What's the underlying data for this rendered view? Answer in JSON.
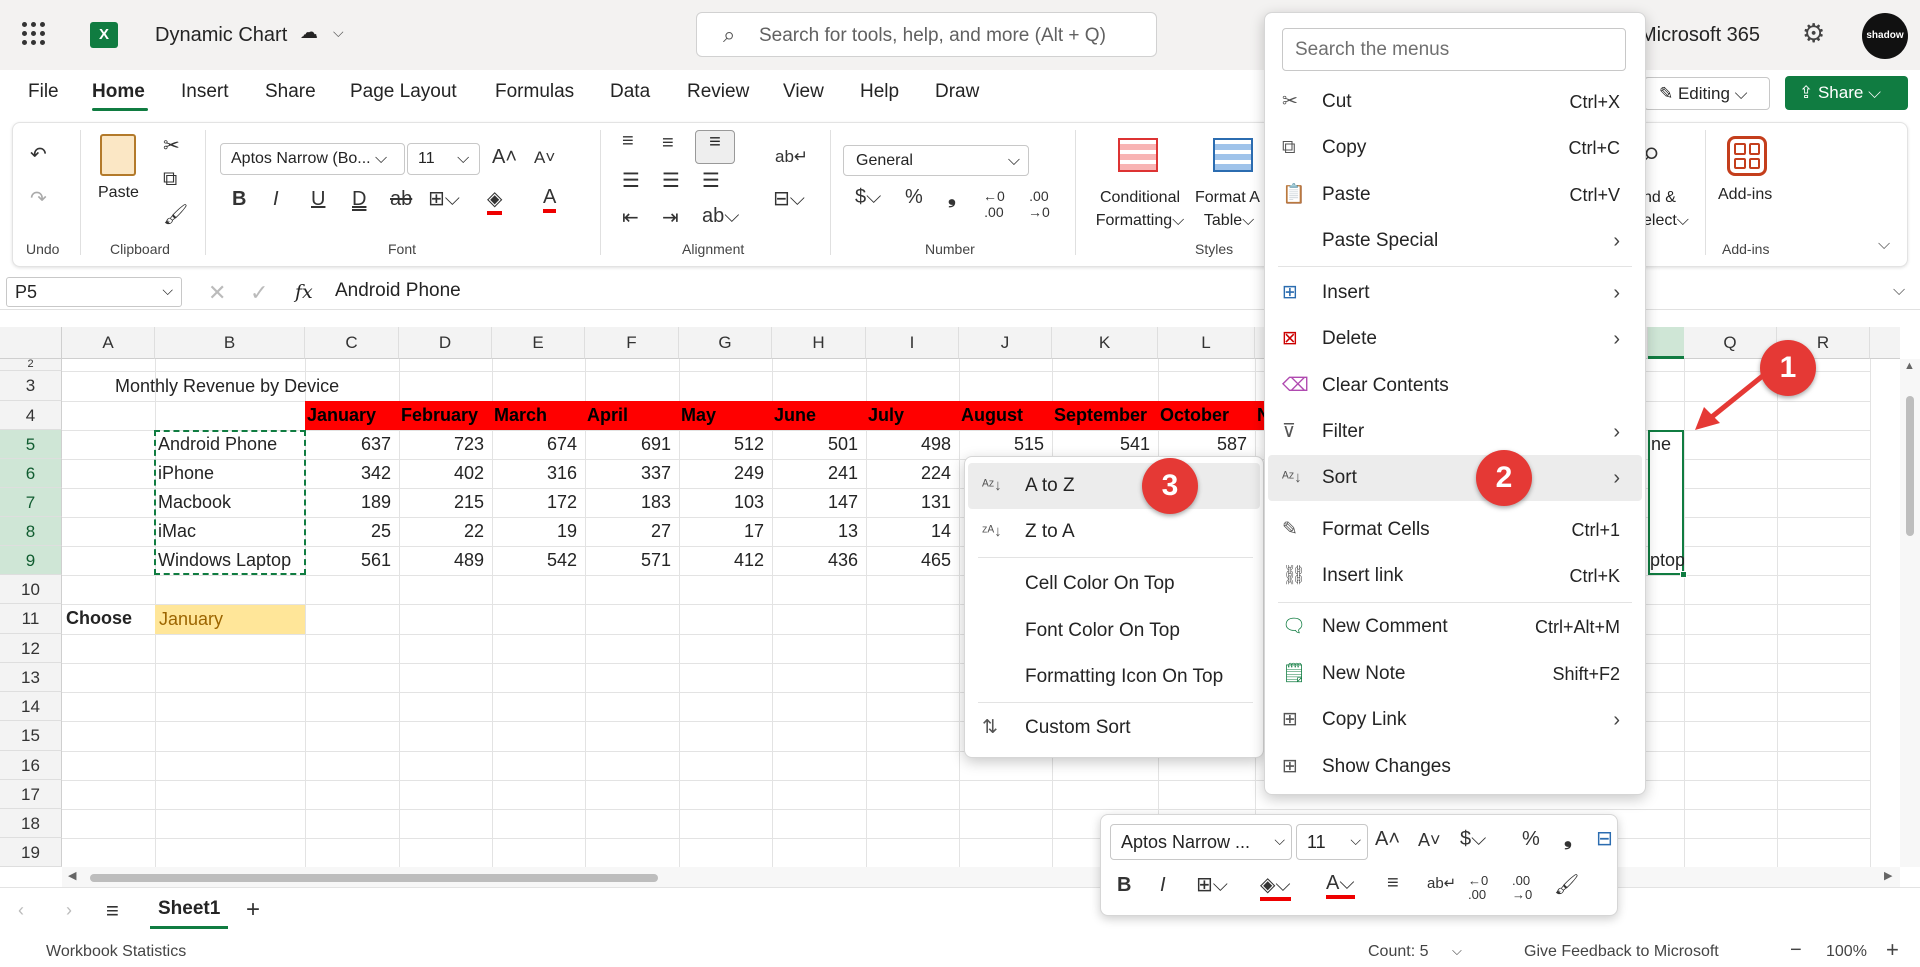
{
  "titlebar": {
    "app_name": "Dynamic Chart",
    "search_placeholder": "Search for tools, help, and more (Alt + Q)",
    "ms365": "Microsoft 365",
    "avatar_text": "shadow"
  },
  "tabs": [
    "File",
    "Home",
    "Insert",
    "Share",
    "Page Layout",
    "Formulas",
    "Data",
    "Review",
    "View",
    "Help",
    "Draw"
  ],
  "mode_button": "Editing",
  "share_button": "Share",
  "ribbon": {
    "undo_group": "Undo",
    "clipboard_group": "Clipboard",
    "paste": "Paste",
    "font_name": "Aptos Narrow (Bo...",
    "font_size": "11",
    "font_group": "Font",
    "alignment_group": "Alignment",
    "number_format": "General",
    "number_group": "Number",
    "conditional_formatting_1": "Conditional",
    "conditional_formatting_2": "Formatting",
    "format_as_table_1": "Format A",
    "format_as_table_2": "Table",
    "styles_group": "Styles",
    "find_select_1": "nd &",
    "find_select_2": "elect",
    "addins": "Add-ins",
    "addins_group": "Add-ins"
  },
  "formula_bar": {
    "name_box": "P5",
    "fx": "fx",
    "value": "Android Phone"
  },
  "columns": [
    "A",
    "B",
    "C",
    "D",
    "E",
    "F",
    "G",
    "H",
    "I",
    "J",
    "K",
    "L",
    "Q",
    "R"
  ],
  "rows": [
    "2",
    "3",
    "4",
    "5",
    "6",
    "7",
    "8",
    "9",
    "10",
    "11",
    "12",
    "13",
    "14",
    "15",
    "16",
    "17",
    "18",
    "19"
  ],
  "sheet": {
    "title": "Monthly Revenue by Device",
    "months": [
      "January",
      "February",
      "March",
      "April",
      "May",
      "June",
      "July",
      "August",
      "September",
      "October",
      "N"
    ],
    "data": [
      {
        "device": "Android Phone",
        "values": [
          "637",
          "723",
          "674",
          "691",
          "512",
          "501",
          "498",
          "515",
          "541",
          "587"
        ]
      },
      {
        "device": "iPhone",
        "values": [
          "342",
          "402",
          "316",
          "337",
          "249",
          "241",
          "224"
        ]
      },
      {
        "device": "Macbook",
        "values": [
          "189",
          "215",
          "172",
          "183",
          "103",
          "147",
          "131"
        ]
      },
      {
        "device": "iMac",
        "values": [
          "25",
          "22",
          "19",
          "27",
          "17",
          "13",
          "14"
        ]
      },
      {
        "device": "Windows Laptop",
        "values": [
          "561",
          "489",
          "542",
          "571",
          "412",
          "436",
          "465"
        ]
      }
    ],
    "choose_label": "Choose",
    "choose_value": "January",
    "partial_p5": "ne",
    "partial_p9": "ptop"
  },
  "context_menu": {
    "search_placeholder": "Search the menus",
    "items": [
      {
        "label": "Cut",
        "shortcut": "Ctrl+X",
        "icon": "scissors-icon"
      },
      {
        "label": "Copy",
        "shortcut": "Ctrl+C",
        "icon": "copy-icon"
      },
      {
        "label": "Paste",
        "shortcut": "Ctrl+V",
        "icon": "paste-icon"
      },
      {
        "label": "Paste Special",
        "shortcut": "",
        "icon": ""
      },
      {
        "label": "Insert",
        "shortcut": "",
        "icon": "insert-cells-icon"
      },
      {
        "label": "Delete",
        "shortcut": "",
        "icon": "delete-cells-icon"
      },
      {
        "label": "Clear Contents",
        "shortcut": "",
        "icon": "eraser-icon"
      },
      {
        "label": "Filter",
        "shortcut": "",
        "icon": "filter-icon"
      },
      {
        "label": "Sort",
        "shortcut": "",
        "icon": "sort-icon"
      },
      {
        "label": "Format Cells",
        "shortcut": "Ctrl+1",
        "icon": "format-cells-icon"
      },
      {
        "label": "Insert link",
        "shortcut": "Ctrl+K",
        "icon": "link-icon"
      },
      {
        "label": "New Comment",
        "shortcut": "Ctrl+Alt+M",
        "icon": "comment-icon"
      },
      {
        "label": "New Note",
        "shortcut": "Shift+F2",
        "icon": "note-icon"
      },
      {
        "label": "Copy Link",
        "shortcut": "",
        "icon": "copy-link-icon"
      },
      {
        "label": "Show Changes",
        "shortcut": "",
        "icon": "show-changes-icon"
      }
    ]
  },
  "sort_submenu": {
    "items": [
      "A to Z",
      "Z to A",
      "Cell Color On Top",
      "Font Color On Top",
      "Formatting Icon On Top",
      "Custom Sort"
    ]
  },
  "badges": [
    "1",
    "2",
    "3"
  ],
  "mini_toolbar": {
    "font_name": "Aptos Narrow ...",
    "font_size": "11"
  },
  "sheet_tab": "Sheet1",
  "status_bar": {
    "workbook_stats": "Workbook Statistics",
    "count": "Count: 5",
    "feedback": "Give Feedback to Microsoft",
    "zoom": "100%"
  },
  "colors": {
    "accent": "#107c41",
    "header_red": "#ff0000",
    "badge": "#e53935",
    "choose_fill": "#ffe699"
  }
}
